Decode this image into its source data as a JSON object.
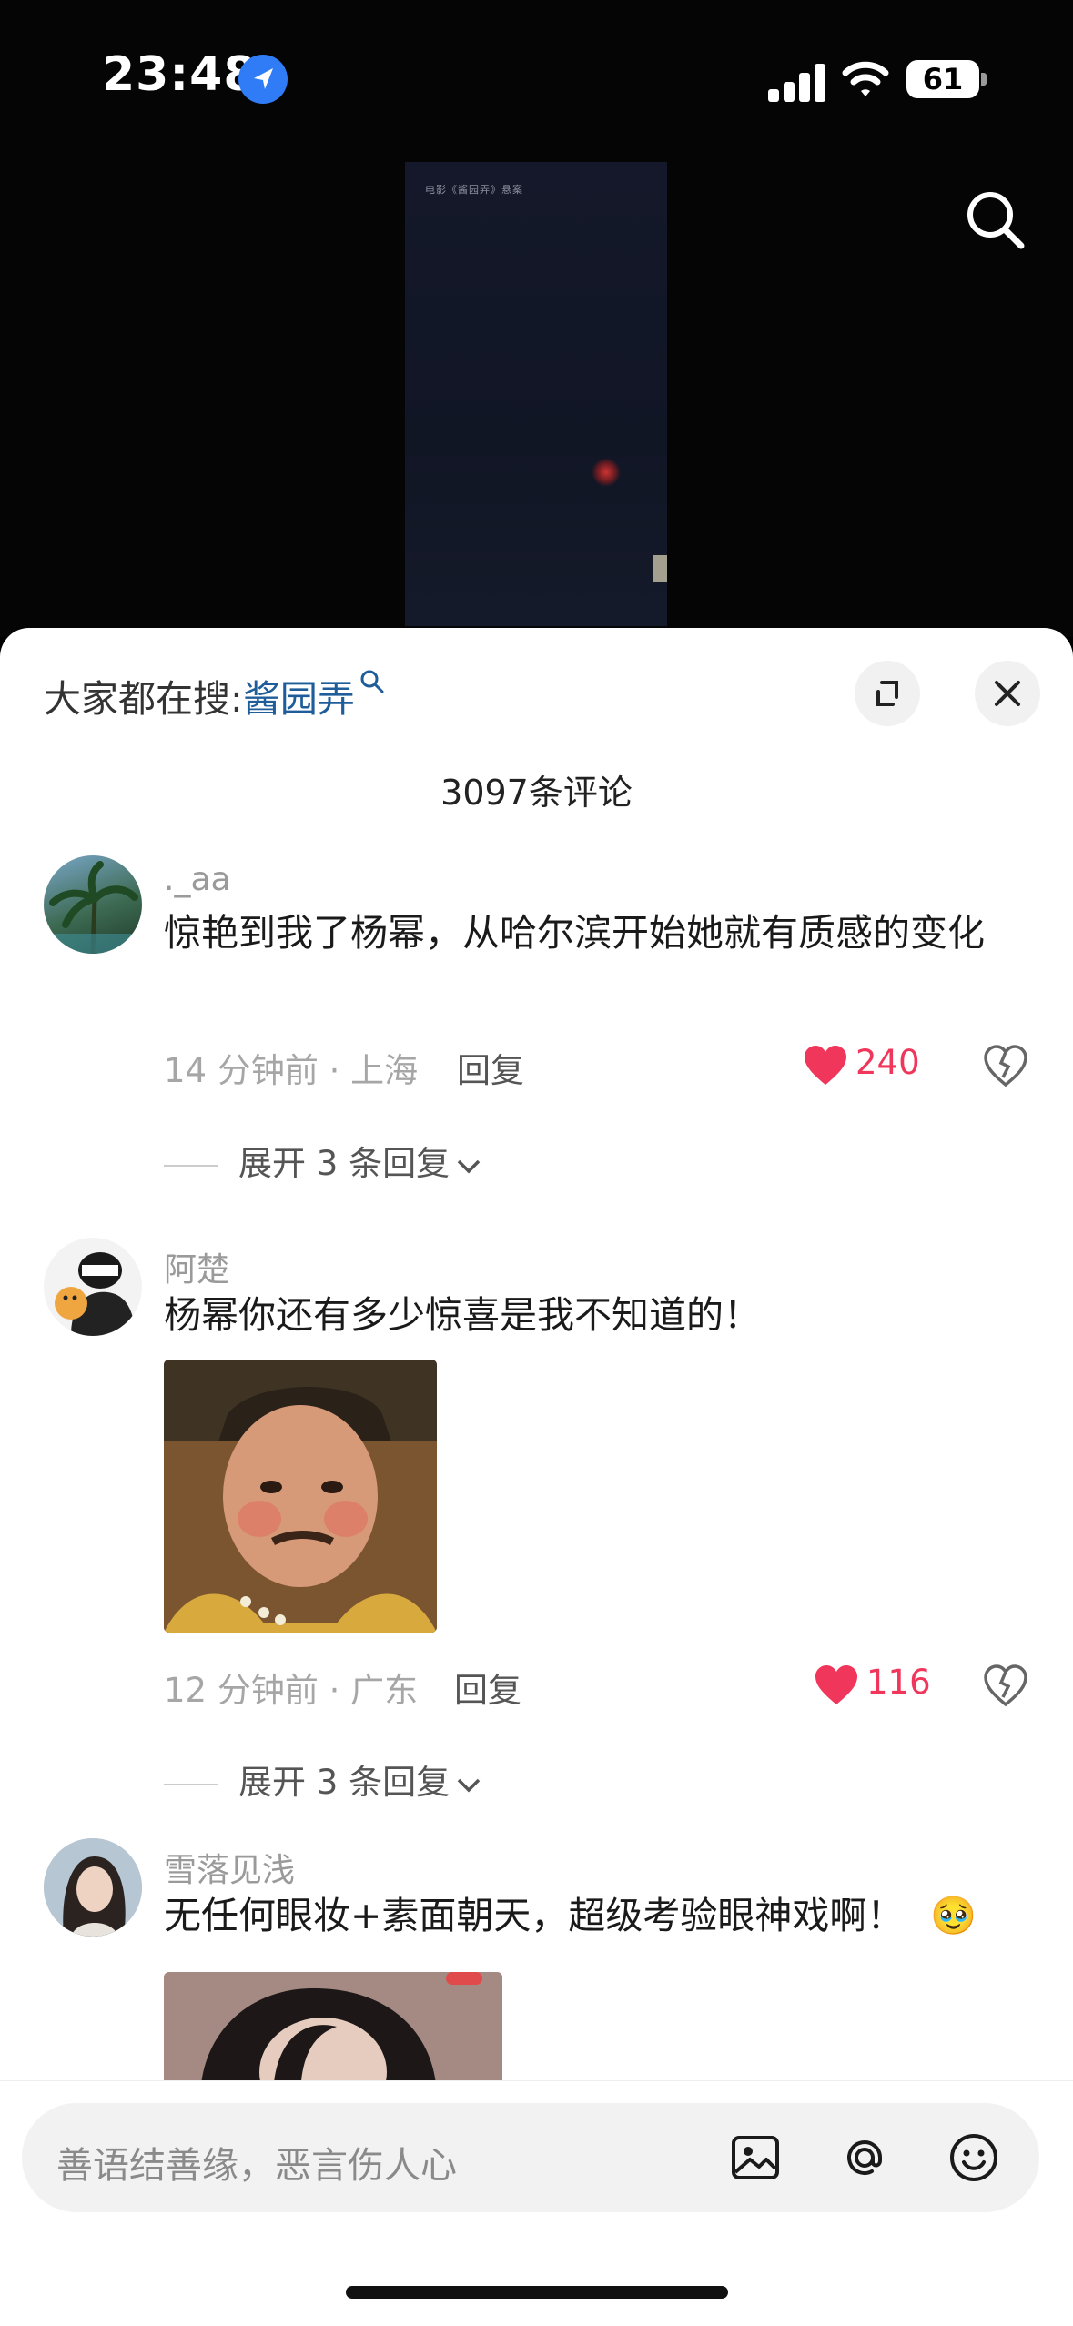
{
  "status_bar": {
    "time": "23:48",
    "battery": "61"
  },
  "video": {
    "caption": "电影《酱园弄》悬案"
  },
  "sheet": {
    "trending_prefix": "大家都在搜:",
    "trending_keyword": "酱园弄",
    "comment_count": "3097条评论",
    "comments": [
      {
        "user": "._aa",
        "text": "惊艳到我了杨幂，从哈尔滨开始她就有质感的变化",
        "meta": "14 分钟前 · 上海",
        "reply": "回复",
        "likes": "240",
        "expand": "展开 3 条回复"
      },
      {
        "user": "阿楚",
        "text": "杨幂你还有多少惊喜是我不知道的！",
        "meta": "12 分钟前 · 广东",
        "reply": "回复",
        "likes": "116",
        "expand": "展开 3 条回复"
      },
      {
        "user": "雪落见浅",
        "text": "无任何眼妆+素面朝天，超级考验眼神戏啊！",
        "emoji": "🥹"
      }
    ]
  },
  "input": {
    "placeholder": "善语结善缘，恶言伤人心"
  },
  "colors": {
    "like": "#f0365a",
    "link": "#1f5d9a",
    "location": "#2f7cf6"
  }
}
